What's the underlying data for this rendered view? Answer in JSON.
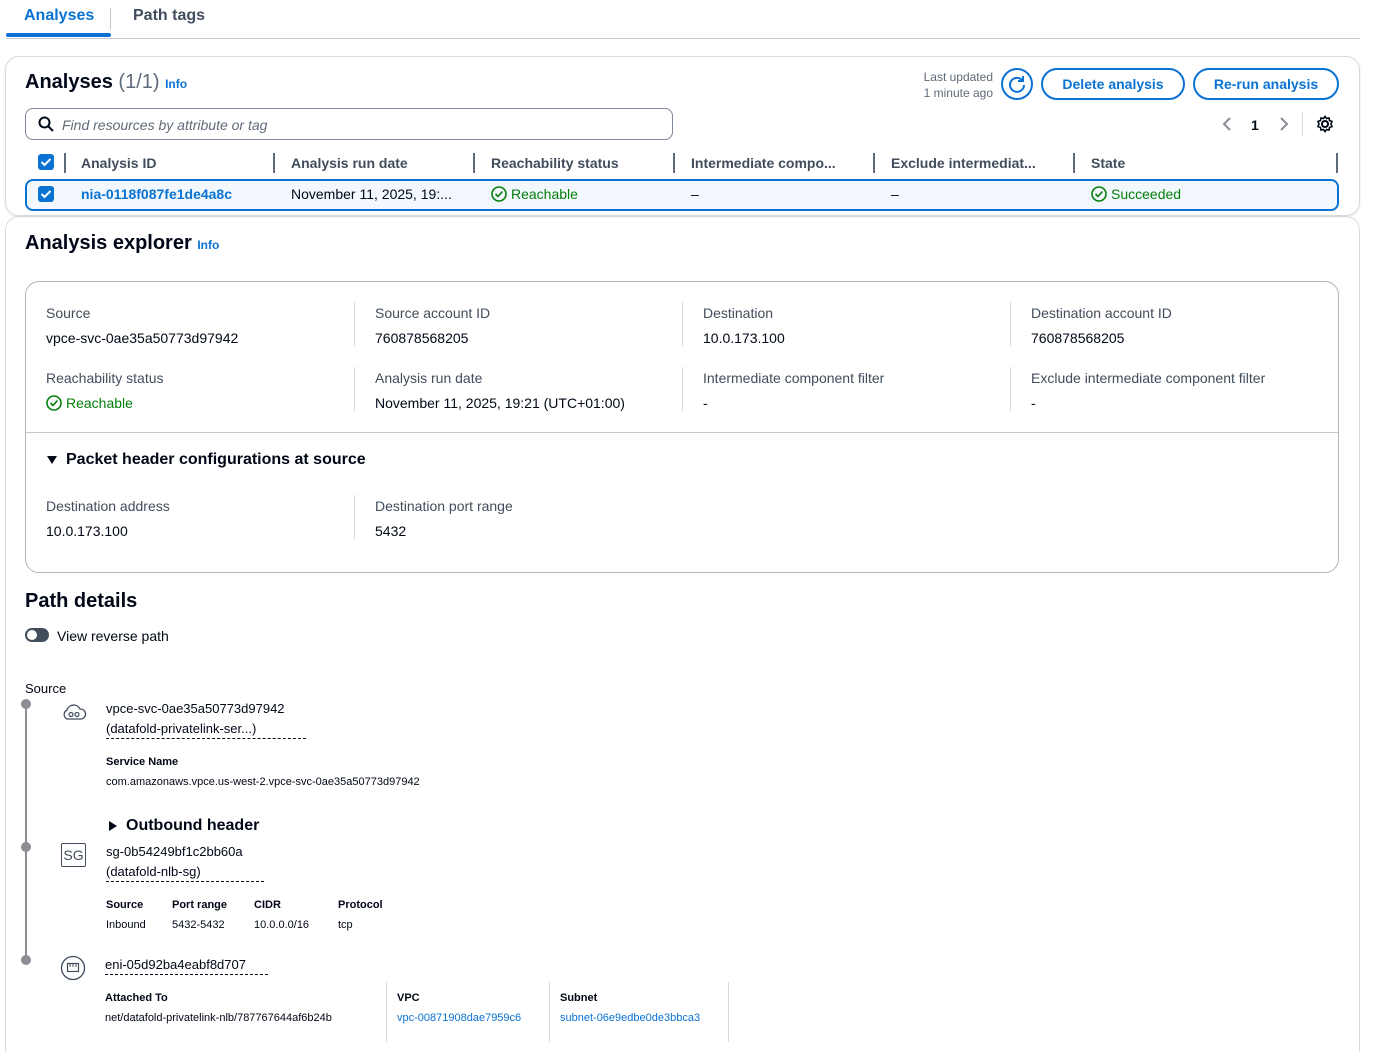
{
  "tabs": [
    {
      "label": "Analyses"
    },
    {
      "label": "Path tags"
    }
  ],
  "analyses": {
    "title": "Analyses",
    "count": "(1/1)",
    "info": "Info",
    "last_updated_line1": "Last updated",
    "last_updated_line2": "1 minute ago",
    "delete_label": "Delete analysis",
    "rerun_label": "Re-run analysis",
    "search_placeholder": "Find resources by attribute or tag",
    "page": "1",
    "columns": [
      "Analysis ID",
      "Analysis run date",
      "Reachability status",
      "Intermediate compo...",
      "Exclude intermediat...",
      "State"
    ],
    "row": {
      "id": "nia-0118f087fe1de4a8c",
      "run_date": "November 11, 2025, 19:...",
      "reachability": "Reachable",
      "intermediate": "–",
      "exclude": "–",
      "state": "Succeeded"
    }
  },
  "explorer": {
    "title": "Analysis explorer",
    "info": "Info",
    "fields": {
      "source_label": "Source",
      "source": "vpce-svc-0ae35a50773d97942",
      "source_account_label": "Source account ID",
      "source_account": "760878568205",
      "destination_label": "Destination",
      "destination": "10.0.173.100",
      "destination_account_label": "Destination account ID",
      "destination_account": "760878568205",
      "reach_label": "Reachability status",
      "reach": "Reachable",
      "run_date_label": "Analysis run date",
      "run_date": "November 11, 2025, 19:21 (UTC+01:00)",
      "icf_label": "Intermediate component filter",
      "icf": "-",
      "eicf_label": "Exclude intermediate component filter",
      "eicf": "-"
    },
    "packet_header_title": "Packet header configurations at source",
    "dest_address_label": "Destination address",
    "dest_address": "10.0.173.100",
    "dest_port_label": "Destination port range",
    "dest_port": "5432"
  },
  "path": {
    "title": "Path details",
    "toggle_label": "View reverse path",
    "source_label": "Source",
    "endpoint": {
      "id": "vpce-svc-0ae35a50773d97942",
      "name": "(datafold-privatelink-ser...)",
      "service_name_label": "Service Name",
      "service_name": "com.amazonaws.vpce.us-west-2.vpce-svc-0ae35a50773d97942"
    },
    "outbound_header": "Outbound header",
    "sg": {
      "icon_text": "SG",
      "id": "sg-0b54249bf1c2bb60a",
      "name": "(datafold-nlb-sg)",
      "headers": [
        "Source",
        "Port range",
        "CIDR",
        "Protocol"
      ],
      "values": [
        "Inbound",
        "5432-5432",
        "10.0.0.0/16",
        "tcp"
      ]
    },
    "eni": {
      "id": "eni-05d92ba4eabf8d707",
      "attached_label": "Attached To",
      "attached": "net/datafold-privatelink-nlb/787767644af6b24b",
      "vpc_label": "VPC",
      "vpc": "vpc-00871908dae7959c6",
      "subnet_label": "Subnet",
      "subnet": "subnet-06e9edbe0de3bbca3"
    }
  },
  "colors": {
    "accent": "#0972d3",
    "success": "#037f0c",
    "text": "#000716"
  }
}
